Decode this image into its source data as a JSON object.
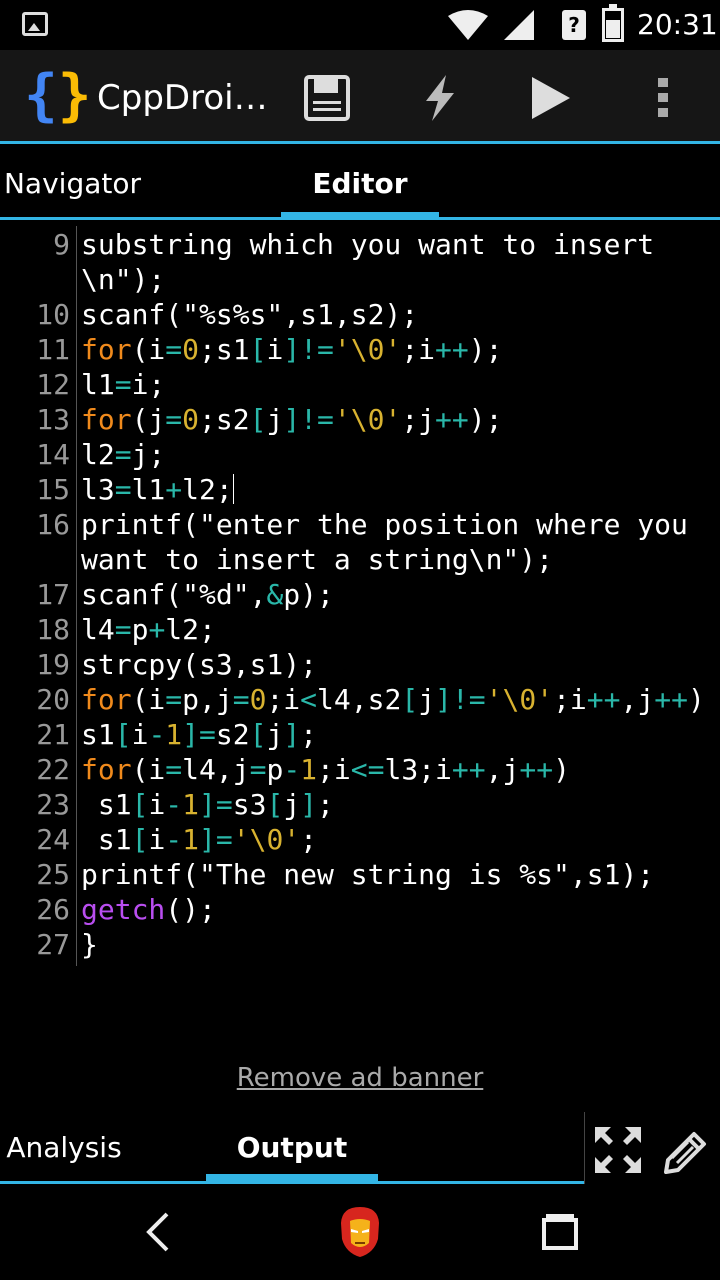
{
  "status_bar": {
    "time": "20:31",
    "icons": [
      "image-notification-icon",
      "wifi-icon",
      "cell-signal-icon",
      "sim-unknown-icon",
      "battery-icon"
    ]
  },
  "toolbar": {
    "app_title": "CppDroi…",
    "logo": {
      "left": "{",
      "right": "}"
    },
    "actions": [
      "save-icon",
      "flash-icon",
      "run-icon",
      "overflow-menu-icon"
    ]
  },
  "tabs": [
    {
      "label": "Navigator",
      "active": false
    },
    {
      "label": "Editor",
      "active": true
    }
  ],
  "editor": {
    "lines": [
      {
        "num": "9",
        "text": "substring which you want to insert"
      },
      {
        "num": "",
        "text": "\\n\");"
      },
      {
        "num": "10",
        "text": "scanf(\"%s%s\",s1,s2);"
      },
      {
        "num": "11",
        "text": "for(i=0;s1[i]!='\\0';i++);"
      },
      {
        "num": "12",
        "text": "l1=i;"
      },
      {
        "num": "13",
        "text": "for(j=0;s2[j]!='\\0';j++);"
      },
      {
        "num": "14",
        "text": "l2=j;"
      },
      {
        "num": "15",
        "text": "l3=l1+l2;"
      },
      {
        "num": "16",
        "text": "printf(\"enter the position where you"
      },
      {
        "num": "",
        "text": "want to insert a string\\n\");"
      },
      {
        "num": "17",
        "text": "scanf(\"%d\",&p);"
      },
      {
        "num": "18",
        "text": "l4=p+l2;"
      },
      {
        "num": "19",
        "text": "strcpy(s3,s1);"
      },
      {
        "num": "20",
        "text": "for(i=p,j=0;i<l4,s2[j]!='\\0';i++,j++)"
      },
      {
        "num": "21",
        "text": "s1[i-1]=s2[j];"
      },
      {
        "num": "22",
        "text": "for(i=l4,j=p-1;i<=l3;i++,j++)"
      },
      {
        "num": "23",
        "text": " s1[i-1]=s3[j];"
      },
      {
        "num": "24",
        "text": " s1[i-1]='\\0';"
      },
      {
        "num": "25",
        "text": "printf(\"The new string is %s\",s1);"
      },
      {
        "num": "26",
        "text": "getch();"
      },
      {
        "num": "27",
        "text": "}"
      }
    ],
    "cursor_line": "15"
  },
  "ad_banner_link": "Remove ad banner",
  "bottom_tabs": [
    {
      "label": "Analysis",
      "active": false
    },
    {
      "label": "Output",
      "active": true
    }
  ],
  "bottom_actions": [
    "fullscreen-icon",
    "edit-pencil-icon"
  ],
  "navbar": [
    "back-icon",
    "home-ironman-icon",
    "recents-icon"
  ],
  "colors": {
    "accent": "#33b5e5",
    "keyword": "#f08a1c",
    "number": "#d8b230",
    "operator": "#2ab7a9",
    "function": "#b94ef0",
    "line_number": "#999999"
  }
}
